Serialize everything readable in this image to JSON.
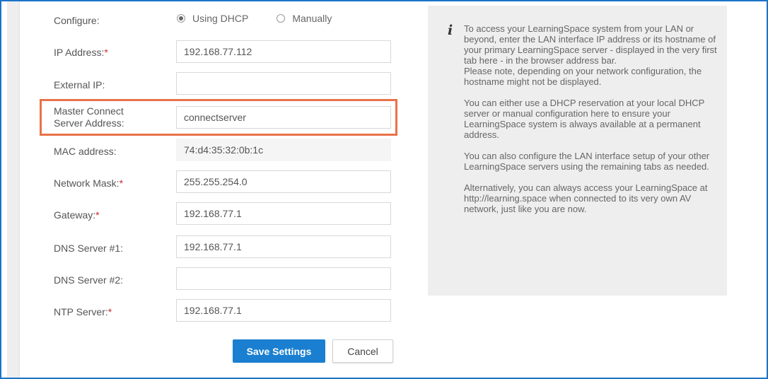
{
  "form": {
    "configure": {
      "label": "Configure:",
      "options": [
        {
          "label": "Using DHCP",
          "selected": true
        },
        {
          "label": "Manually",
          "selected": false
        }
      ]
    },
    "ip_address": {
      "label": "IP Address:",
      "required": "*",
      "value": "192.168.77.112"
    },
    "external_ip": {
      "label": "External IP:",
      "value": ""
    },
    "master_connect": {
      "label_line1": "Master Connect",
      "label_line2": "Server Address:",
      "value": "connectserver"
    },
    "mac_address": {
      "label": "MAC address:",
      "value": "74:d4:35:32:0b:1c"
    },
    "network_mask": {
      "label": "Network Mask:",
      "required": "*",
      "value": "255.255.254.0"
    },
    "gateway": {
      "label": "Gateway:",
      "required": "*",
      "value": "192.168.77.1"
    },
    "dns1": {
      "label": "DNS Server #1:",
      "value": "192.168.77.1"
    },
    "dns2": {
      "label": "DNS Server #2:",
      "value": ""
    },
    "ntp": {
      "label": "NTP Server:",
      "required": "*",
      "value": "192.168.77.1"
    },
    "save_label": "Save Settings",
    "cancel_label": "Cancel"
  },
  "info": {
    "icon": "info-icon",
    "icon_glyph": "i",
    "paragraphs": [
      "To access your LearningSpace system from your LAN or beyond, enter the LAN interface IP address or its hostname of your primary LearningSpace server - displayed in the very first tab here - in the browser address bar.",
      "Please note, depending on your network configuration, the hostname might not be displayed.",
      "You can either use a DHCP reservation at your local DHCP server or manual configuration here to ensure your LearningSpace system is always available at a permanent address.",
      "You can also configure the LAN interface setup of your other LearningSpace servers using the remaining tabs as needed.",
      "Alternatively, you can always access your LearningSpace at http://learning.space when connected to its very own AV network, just like you are now."
    ]
  },
  "colors": {
    "accent": "#1a7fd0",
    "highlight": "#e8724a",
    "required": "#c9302c",
    "frame": "#1a73c9"
  }
}
